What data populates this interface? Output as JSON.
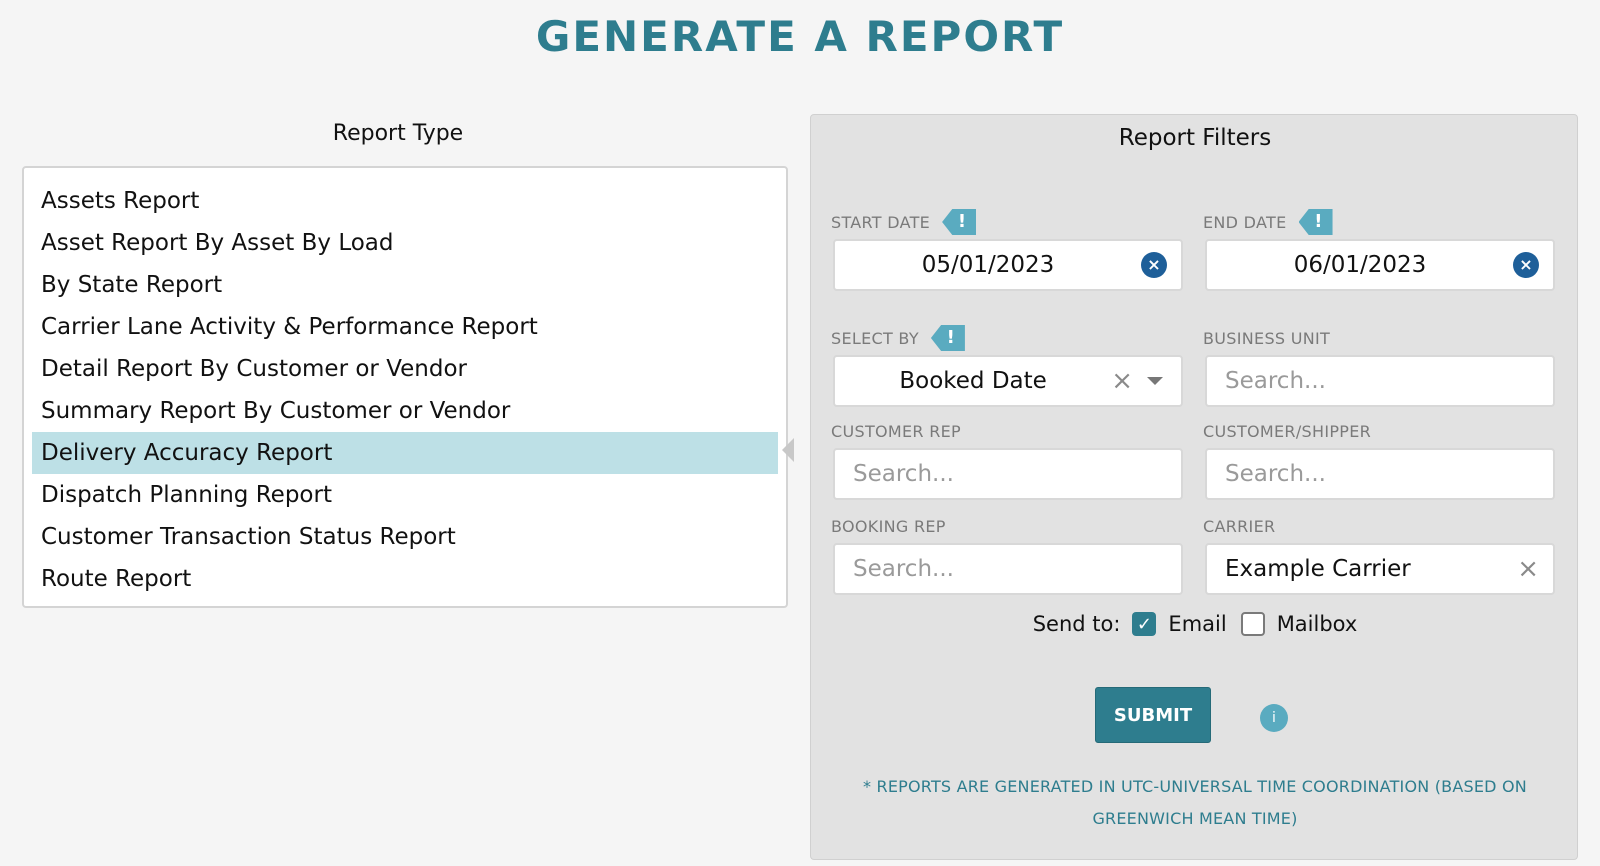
{
  "page_title": "GENERATE A REPORT",
  "report_type": {
    "heading": "Report Type",
    "items": [
      {
        "label": "Assets Report",
        "selected": false
      },
      {
        "label": "Asset Report By Asset By Load",
        "selected": false
      },
      {
        "label": "By State Report",
        "selected": false
      },
      {
        "label": "Carrier Lane Activity & Performance Report",
        "selected": false
      },
      {
        "label": "Detail Report By Customer or Vendor",
        "selected": false
      },
      {
        "label": "Summary Report By Customer or Vendor",
        "selected": false
      },
      {
        "label": "Delivery Accuracy Report",
        "selected": true
      },
      {
        "label": "Dispatch Planning Report",
        "selected": false
      },
      {
        "label": "Customer Transaction Status Report",
        "selected": false
      },
      {
        "label": "Route Report",
        "selected": false
      }
    ]
  },
  "filters": {
    "heading": "Report Filters",
    "start_date": {
      "label": "START DATE",
      "value": "05/01/2023",
      "required_flag": "!",
      "clear_glyph": "×"
    },
    "end_date": {
      "label": "END DATE",
      "value": "06/01/2023",
      "required_flag": "!",
      "clear_glyph": "×"
    },
    "select_by": {
      "label": "SELECT BY",
      "value": "Booked Date",
      "required_flag": "!",
      "clear_glyph": "×"
    },
    "business_unit": {
      "label": "BUSINESS UNIT",
      "placeholder": "Search..."
    },
    "customer_rep": {
      "label": "CUSTOMER REP",
      "placeholder": "Search..."
    },
    "customer_shipper": {
      "label": "CUSTOMER/SHIPPER",
      "placeholder": "Search..."
    },
    "booking_rep": {
      "label": "BOOKING REP",
      "placeholder": "Search..."
    },
    "carrier": {
      "label": "CARRIER",
      "value": "Example Carrier",
      "clear_glyph": "×"
    },
    "send_to": {
      "label": "Send to:",
      "email": {
        "label": "Email",
        "checked": true,
        "check_glyph": "✓"
      },
      "mailbox": {
        "label": "Mailbox",
        "checked": false
      }
    },
    "submit_label": "SUBMIT",
    "info_glyph": "i",
    "note": "* REPORTS ARE GENERATED IN UTC-UNIVERSAL TIME COORDINATION (BASED ON GREENWICH MEAN TIME)"
  },
  "colors": {
    "accent": "#2e7d8e",
    "flag": "#5aabc0",
    "selected_row": "#bde0e6",
    "clear_button": "#1e5f99"
  }
}
